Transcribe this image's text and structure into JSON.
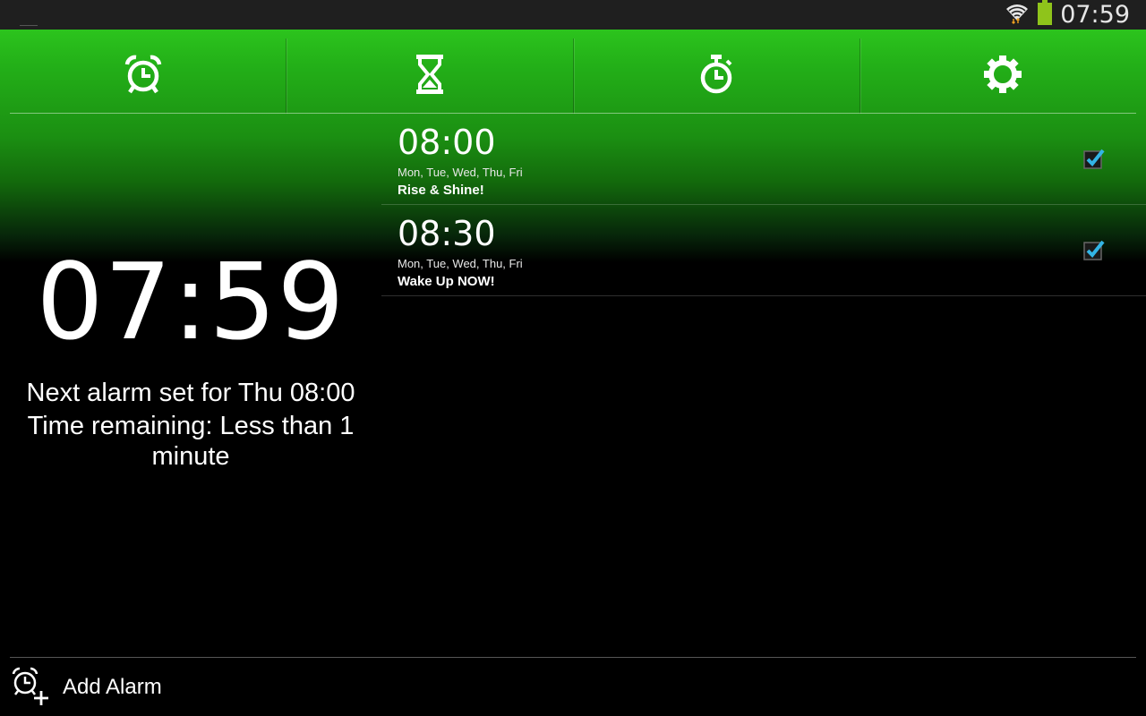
{
  "status_bar": {
    "time": "07:59",
    "icons": [
      "wifi-icon",
      "battery-icon"
    ],
    "battery_color": "#8fc41b"
  },
  "tabs": [
    {
      "name": "alarm",
      "icon": "alarm-clock-icon"
    },
    {
      "name": "timer",
      "icon": "hourglass-icon"
    },
    {
      "name": "stopwatch",
      "icon": "stopwatch-icon"
    },
    {
      "name": "settings",
      "icon": "gear-icon"
    }
  ],
  "clock": {
    "time": "07:59",
    "next_alarm": "Next alarm set for Thu 08:00",
    "time_remaining": "Time remaining: Less than 1 minute"
  },
  "alarms": [
    {
      "time": "08:00",
      "days": "Mon, Tue, Wed, Thu, Fri",
      "label": "Rise & Shine!",
      "enabled": true
    },
    {
      "time": "08:30",
      "days": "Mon, Tue, Wed, Thu, Fri",
      "label": "Wake Up NOW!",
      "enabled": true
    }
  ],
  "footer": {
    "add_alarm_label": "Add Alarm"
  },
  "colors": {
    "accent_green": "#23b018",
    "check_blue": "#33b5e5"
  }
}
